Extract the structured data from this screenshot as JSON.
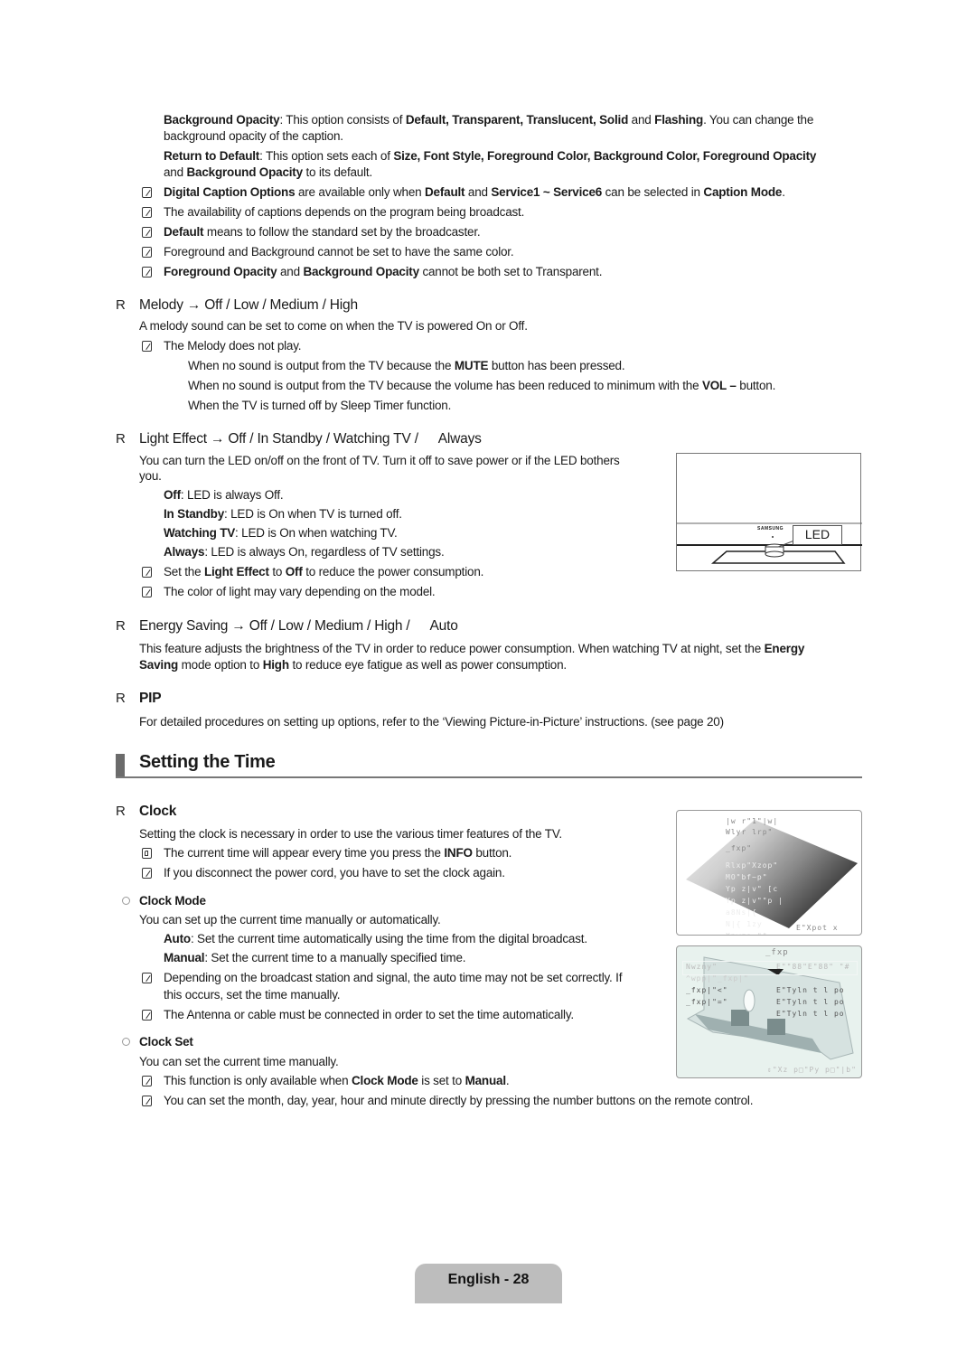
{
  "caption_options": {
    "bg_opacity": {
      "term": "Background Opacity",
      "text1": ": This option consists of ",
      "opts": "Default, Transparent, Translucent, Solid",
      "and": " and ",
      "flashing": "Flashing",
      "text2": ". You can change the",
      "line2": "background opacity of the caption."
    },
    "return_default": {
      "term": "Return to Default",
      "text1": ": This option sets each of ",
      "opts": "Size, Font Style, Foreground Color, Background Color, Foreground Opacity",
      "line2_and": "and ",
      "line2_term": "Background Opacity",
      "line2_rest": " to its default."
    },
    "notes": [
      {
        "b1": "Digital Caption Options",
        "t1": " are available only when ",
        "b2": "Default",
        "t2": " and ",
        "b3": "Service1 ~ Service6",
        "t3": " can be selected in ",
        "b4": "Caption Mode",
        "t4": "."
      },
      {
        "t1": "The availability of captions depends on the program being broadcast."
      },
      {
        "b1": "Default",
        "t1": " means to follow the standard set by the broadcaster."
      },
      {
        "t1": "Foreground and Background cannot be set to have the same color."
      },
      {
        "b1": "Foreground Opacity",
        "t1": " and ",
        "b2": "Background Opacity",
        "t2": " cannot be both set to Transparent."
      }
    ]
  },
  "melody": {
    "marker": "R",
    "heading": "Melody → Off / Low / Medium / High",
    "desc": "A melody sound can be set to come on when the TV is powered On or Off.",
    "note": "The Melody does not play.",
    "cases": [
      {
        "t1": "When no sound is output from the TV because the ",
        "b1": "MUTE",
        "t2": " button has been pressed."
      },
      {
        "t1": "When no sound is output from the TV because the volume has been reduced to minimum with the ",
        "b1": "VOL –",
        "t2": " button."
      },
      {
        "t1": "When the TV is turned off by Sleep Timer function."
      }
    ]
  },
  "light_effect": {
    "marker": "R",
    "heading": "Light Effect → Off / In Standby / Watching TV /",
    "heading_last": "Always",
    "desc_line1": "You can turn the LED on/off on the front of TV. Turn it off to save power or if the LED bothers",
    "desc_line2": "you.",
    "options": [
      {
        "term": "Off",
        "text": ": LED is always Off."
      },
      {
        "term": "In Standby",
        "text": ": LED is On when TV is turned off."
      },
      {
        "term": "Watching TV",
        "text": ": LED is On when watching TV."
      },
      {
        "term": "Always",
        "text": ": LED is always On, regardless of TV settings."
      }
    ],
    "notes": [
      {
        "t1": "Set the ",
        "b1": "Light Effect",
        "t2": " to ",
        "b2": "Off",
        "t3": " to reduce the power consumption."
      },
      {
        "t1": "The color of light may vary depending on the model."
      }
    ],
    "figure": {
      "brand": "SAMSUNG",
      "callout": "LED"
    }
  },
  "energy_saving": {
    "marker": "R",
    "heading": "Energy Saving → Off / Low / Medium / High /",
    "heading_last": "Auto",
    "line1": "This feature adjusts the brightness of the TV in order to reduce power consumption. When watching TV at night, set the ",
    "line1_bold": "Energy",
    "line2_bold1": "Saving",
    "line2_t1": " mode option to ",
    "line2_bold2": "High",
    "line2_t2": " to reduce eye fatigue as well as power consumption."
  },
  "pip": {
    "marker": "R",
    "heading": "PIP",
    "desc": "For detailed procedures on setting up options, refer to the ‘Viewing Picture-in-Picture’ instructions. (see page 20)"
  },
  "section": {
    "title": "Setting the Time"
  },
  "clock": {
    "marker": "R",
    "heading": "Clock",
    "desc": "Setting the clock is necessary in order to use the various timer features of the TV.",
    "tip": {
      "t1": "The current time will appear every time you press the ",
      "b1": "INFO",
      "t2": " button."
    },
    "note": "If you disconnect the power cord, you have to set the clock again.",
    "clock_mode": {
      "heading": "Clock Mode",
      "desc": "You can set up the current time manually or automatically.",
      "options": [
        {
          "term": "Auto",
          "text": ": Set the current time automatically using the time from the digital broadcast."
        },
        {
          "term": "Manual",
          "text": ": Set the current time to a manually specified time."
        }
      ],
      "notes": [
        {
          "line1": "Depending on the broadcast station and signal, the auto time may not be set correctly. If",
          "line2": "this occurs, set the time manually."
        },
        {
          "line1": "The Antenna or cable must be connected in order to set the time automatically."
        }
      ]
    },
    "clock_set": {
      "heading": "Clock Set",
      "desc": "You can set the current time manually.",
      "notes": [
        {
          "t1": "This function is only available when ",
          "b1": "Clock Mode",
          "t2": " is set to ",
          "b2": "Manual",
          "t3": "."
        },
        {
          "t1": "You can set the month, day, year, hour and minute directly by pressing the number buttons on the remote control."
        }
      ]
    },
    "osd1": {
      "lines": [
        "|w r\"1\"|w|",
        "Wlyr lrp\"",
        "_fxp\"",
        "Rlxp\"Xzop\"",
        "MO\"bf~p\"",
        "Yp  z|v\"  [c",
        "Yp  z|v\"\"p  |",
        "a8Ns|{",
        "N|{ 1zy",
        "Xpwzo \"\""
      ],
      "right": "E\"Xpot x"
    },
    "osd2": {
      "title": "_fxp",
      "rows": [
        {
          "l": "Nwzny\"",
          "r": "E\"\"88\"E\"88\"   \"#"
        },
        {
          "l": "^wpp|\"_fxp|\"",
          "r": ""
        },
        {
          "l": "_fxp|\"<\"",
          "r": "E\"Tyln t l po"
        },
        {
          "l": "_fxp|\"=\"",
          "r": "E\"Tyln t l po"
        },
        {
          "l": "",
          "r": "E\"Tyln t l po"
        }
      ],
      "footer": "⇕\"Xz p□\"Py p□\"|b\""
    }
  },
  "footer": {
    "label": "English - 28"
  }
}
